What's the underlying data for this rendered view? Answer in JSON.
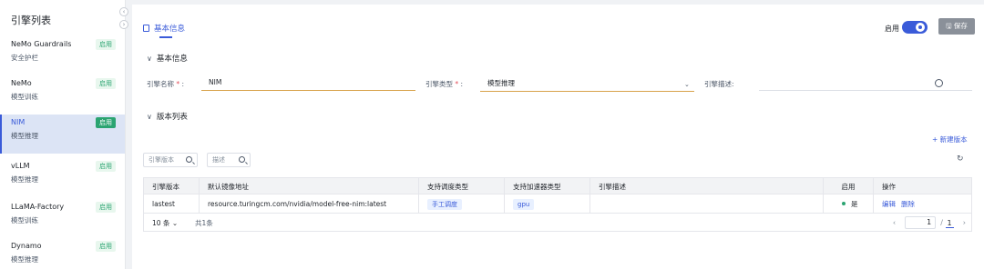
{
  "sidebar": {
    "title": "引擎列表",
    "items": [
      {
        "name": "NeMo Guardrails",
        "sub": "安全护栏",
        "badge": "启用"
      },
      {
        "name": "NeMo",
        "sub": "模型训练",
        "badge": "启用"
      },
      {
        "name": "NIM",
        "sub": "模型推理",
        "badge": "启用"
      },
      {
        "name": "vLLM",
        "sub": "模型推理",
        "badge": "启用"
      },
      {
        "name": "LLaMA-Factory",
        "sub": "模型训练",
        "badge": "启用"
      },
      {
        "name": "Dynamo",
        "sub": "模型推理",
        "badge": "启用"
      }
    ]
  },
  "header": {
    "tab": "基本信息",
    "enable_label": "启用",
    "enabled": true,
    "save": "保存"
  },
  "basic": {
    "heading": "基本信息",
    "name_label": "引擎名称",
    "name_value": "NIM",
    "type_label": "引擎类型",
    "type_value": "模型推理",
    "desc_label": "引擎描述:",
    "desc_value": ""
  },
  "versions": {
    "heading": "版本列表",
    "new_button": "新建版本",
    "search_version_placeholder": "引擎版本",
    "search_desc_placeholder": "描述",
    "columns": [
      "引擎版本",
      "默认镜像地址",
      "支持调度类型",
      "支持加速器类型",
      "引擎描述",
      "启用",
      "操作"
    ],
    "rows": [
      {
        "version": "lastest",
        "image": "resource.turingcm.com/nvidia/model-free-nim:latest",
        "schedule": "手工调度",
        "accel": "gpu",
        "desc": "",
        "enabled": "是",
        "edit": "编辑",
        "delete": "删除"
      }
    ],
    "page_size": "10 条",
    "total": "共1条",
    "page_current": "1",
    "page_total": "1"
  }
}
